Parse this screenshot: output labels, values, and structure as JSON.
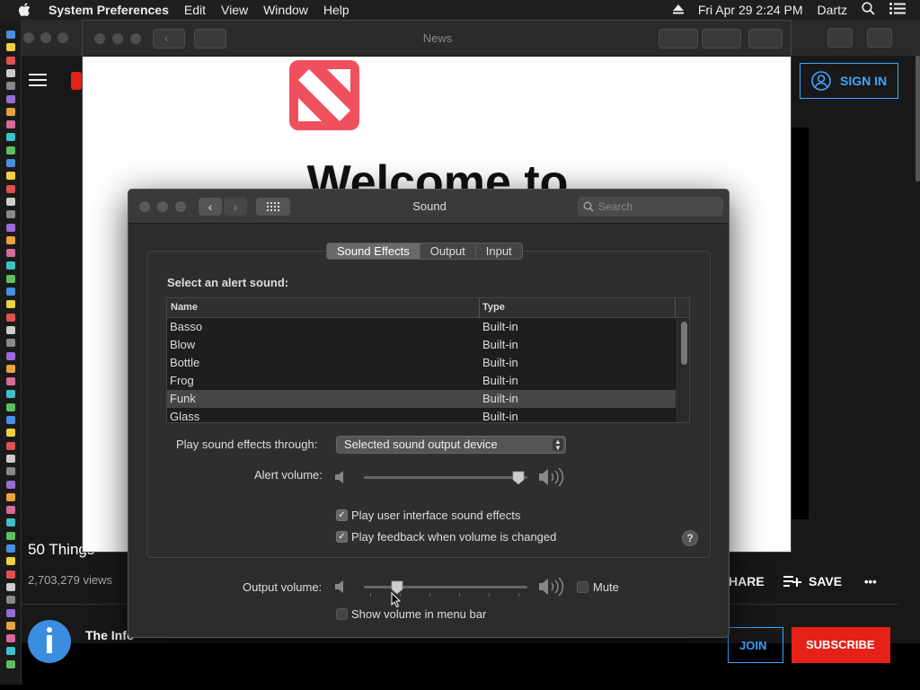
{
  "menubar": {
    "app": "System Preferences",
    "items": [
      "Edit",
      "View",
      "Window",
      "Help"
    ],
    "datetime": "Fri Apr 29  2:24 PM",
    "user": "Dartz"
  },
  "news": {
    "title": "News",
    "welcome": "Welcome to"
  },
  "youtube": {
    "sign_in": "SIGN IN",
    "video_title": "50 Things",
    "views": "2,703,279 views",
    "share": "HARE",
    "save": "SAVE",
    "more": "•••",
    "channel": "The Info",
    "join": "JOIN",
    "subscribe": "SUBSCRIBE"
  },
  "sound": {
    "title": "Sound",
    "search_placeholder": "Search",
    "tabs": [
      "Sound Effects",
      "Output",
      "Input"
    ],
    "active_tab": "Sound Effects",
    "select_label": "Select an alert sound:",
    "columns": {
      "name": "Name",
      "type": "Type"
    },
    "rows": [
      {
        "name": "Basso",
        "type": "Built-in"
      },
      {
        "name": "Blow",
        "type": "Built-in"
      },
      {
        "name": "Bottle",
        "type": "Built-in"
      },
      {
        "name": "Frog",
        "type": "Built-in"
      },
      {
        "name": "Funk",
        "type": "Built-in"
      },
      {
        "name": "Glass",
        "type": "Built-in"
      }
    ],
    "selected_row": "Funk",
    "play_through_label": "Play sound effects through:",
    "play_through_value": "Selected sound output device",
    "alert_volume_label": "Alert volume:",
    "alert_volume": 0.98,
    "checkbox_ui": "Play user interface sound effects",
    "checkbox_ui_checked": true,
    "checkbox_feedback": "Play feedback when volume is changed",
    "checkbox_feedback_checked": true,
    "help": "?",
    "output_volume_label": "Output volume:",
    "output_volume": 0.18,
    "mute_label": "Mute",
    "mute_checked": false,
    "show_volume_label": "Show volume in menu bar",
    "show_volume_checked": false
  },
  "colors": {
    "news_red": "#f0505e",
    "youtube_red": "#e62117",
    "accent_blue": "#3ea6ff"
  }
}
